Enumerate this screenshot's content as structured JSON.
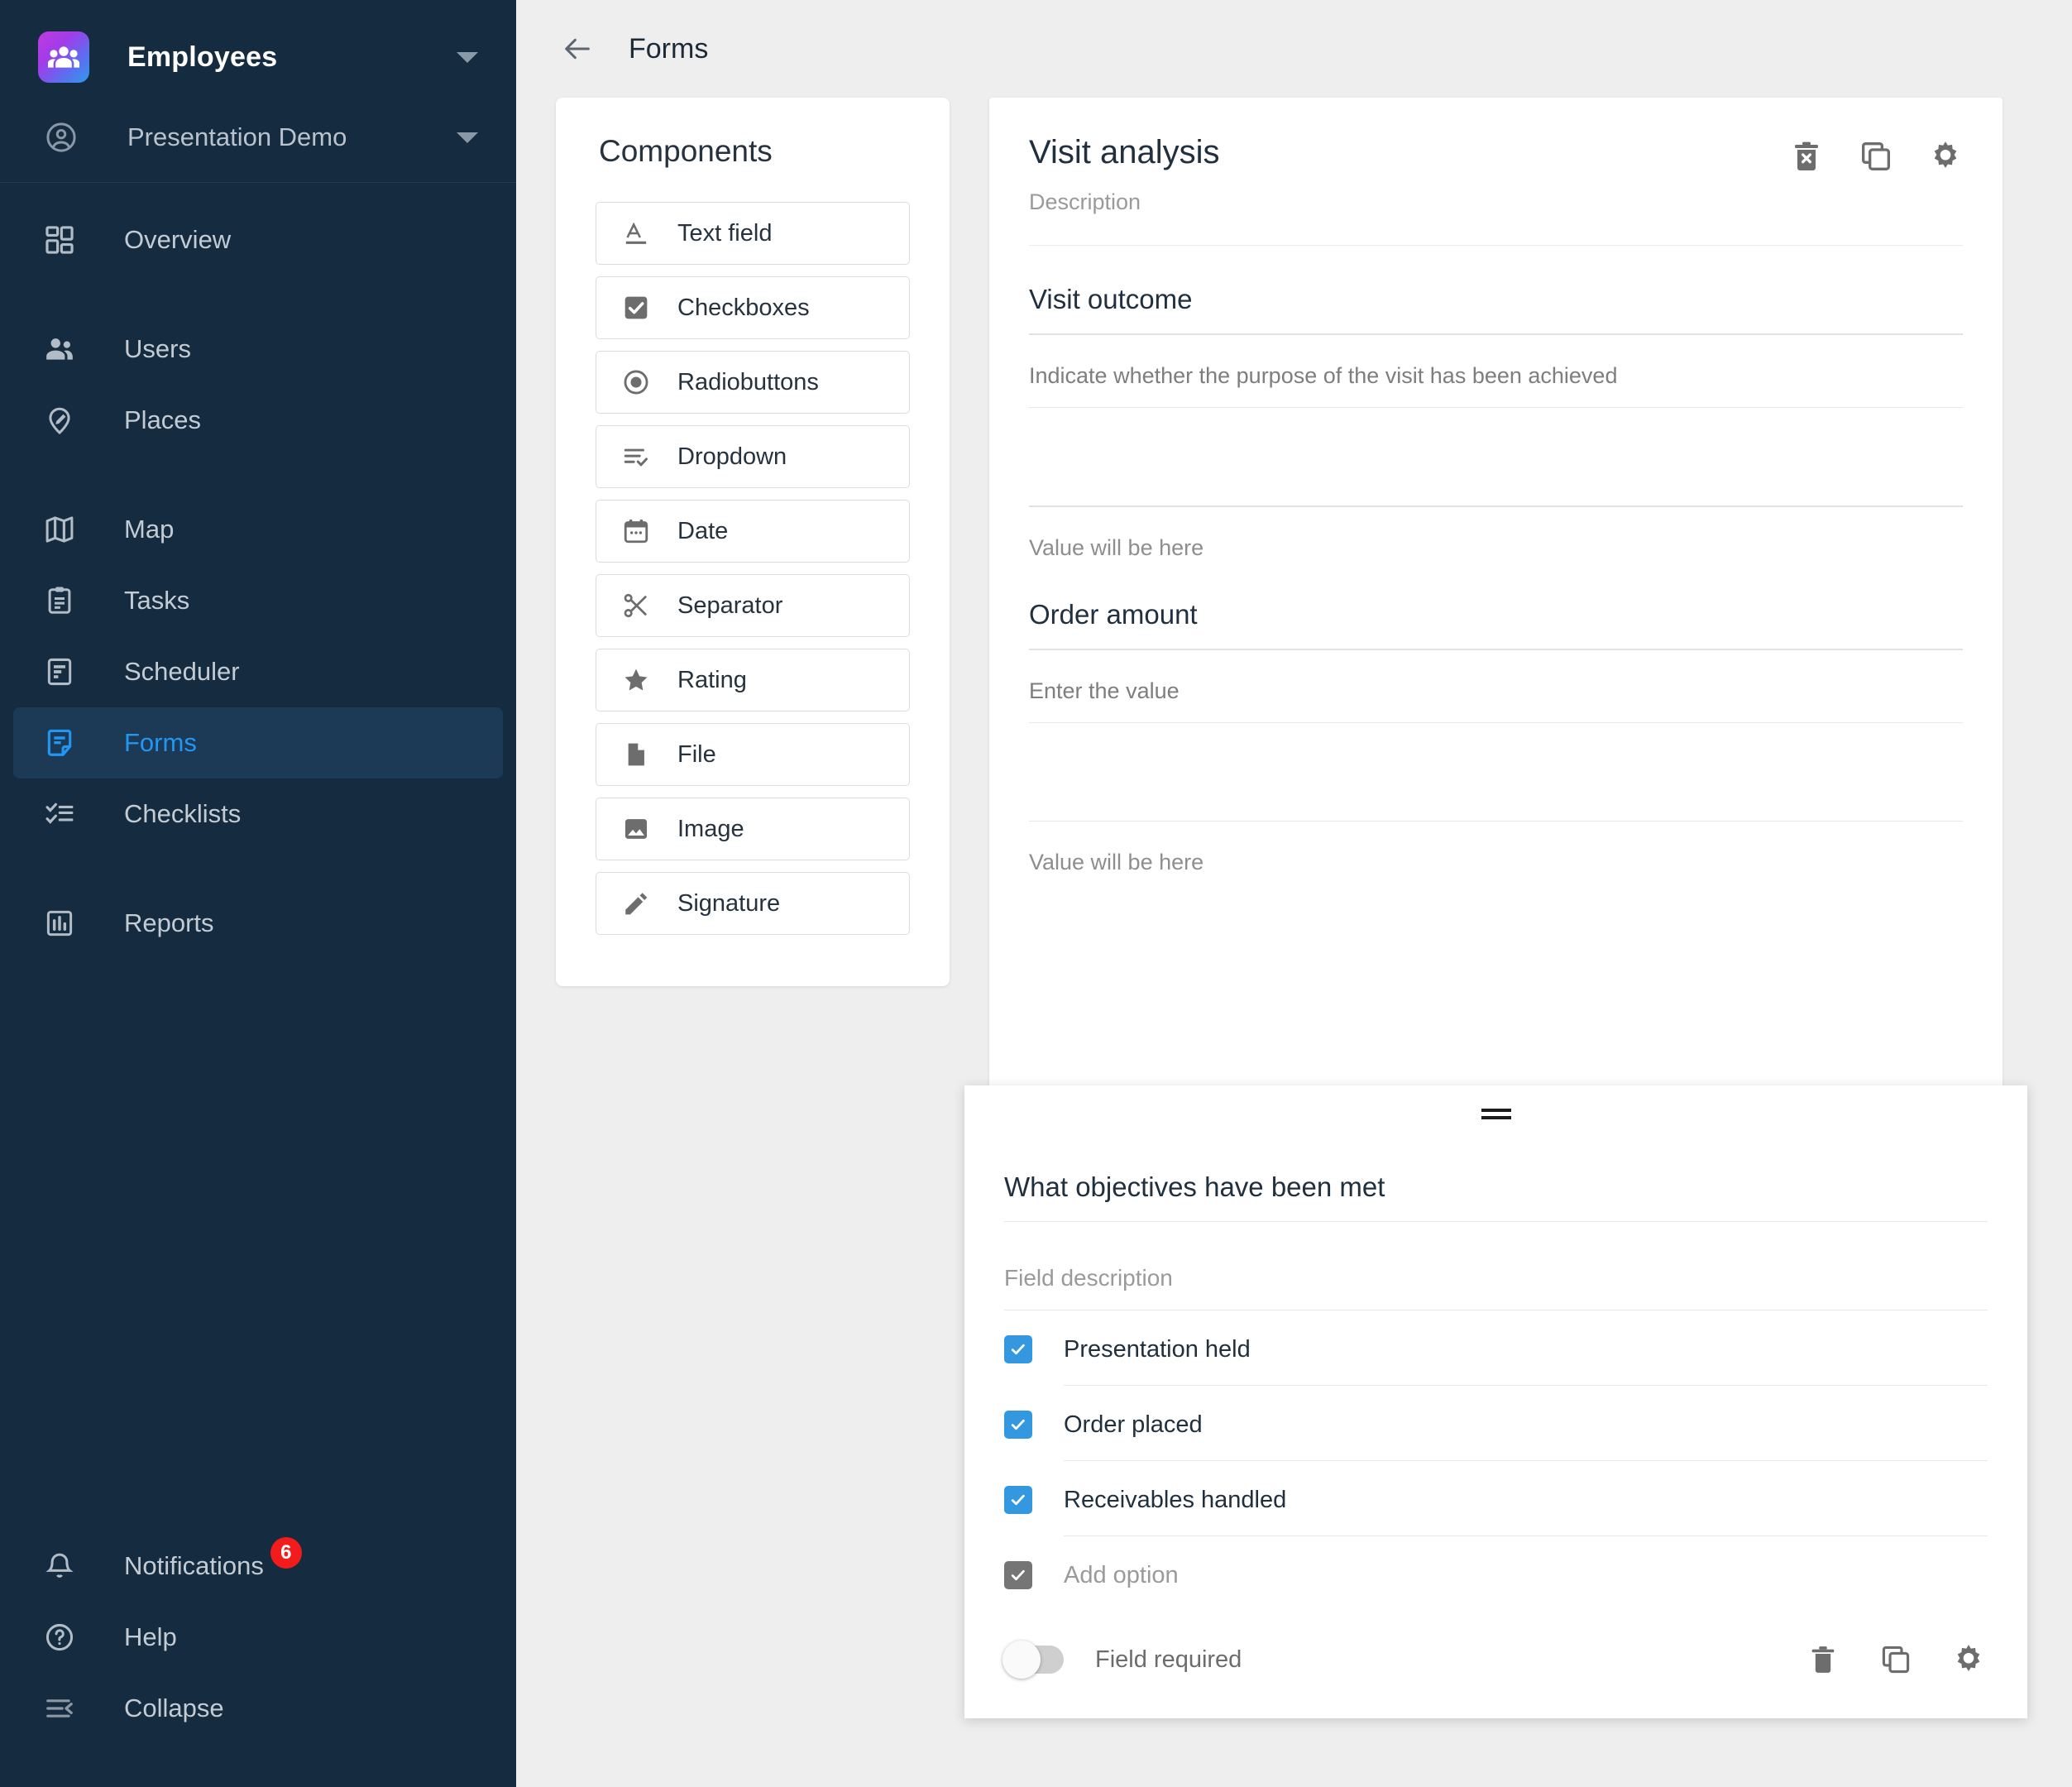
{
  "sidebar": {
    "brand": {
      "name": "Employees",
      "icon": "people-group-icon",
      "caret": "chevron-down-icon"
    },
    "account": {
      "name": "Presentation Demo",
      "icon": "account-circle-icon",
      "caret": "chevron-down-icon"
    },
    "nav": [
      {
        "label": "Overview",
        "icon": "dashboard-icon",
        "active": false
      },
      {
        "label": "Users",
        "icon": "users-icon",
        "active": false
      },
      {
        "label": "Places",
        "icon": "place-pin-edit-icon",
        "active": false
      },
      {
        "label": "Map",
        "icon": "map-icon",
        "active": false
      },
      {
        "label": "Tasks",
        "icon": "clipboard-tasks-icon",
        "active": false
      },
      {
        "label": "Scheduler",
        "icon": "scheduler-icon",
        "active": false
      },
      {
        "label": "Forms",
        "icon": "forms-icon",
        "active": true
      },
      {
        "label": "Checklists",
        "icon": "checklist-icon",
        "active": false
      },
      {
        "label": "Reports",
        "icon": "reports-bar-chart-icon",
        "active": false
      }
    ],
    "bottom": [
      {
        "label": "Notifications",
        "icon": "bell-icon",
        "badge": "6"
      },
      {
        "label": "Help",
        "icon": "help-circle-icon",
        "badge": ""
      },
      {
        "label": "Collapse",
        "icon": "collapse-menu-icon",
        "badge": ""
      }
    ]
  },
  "topbar": {
    "back_icon": "arrow-back-icon",
    "title": "Forms"
  },
  "components": {
    "title": "Components",
    "items": [
      {
        "label": "Text field",
        "icon": "text-field-icon"
      },
      {
        "label": "Checkboxes",
        "icon": "checkbox-icon"
      },
      {
        "label": "Radiobuttons",
        "icon": "radio-button-icon"
      },
      {
        "label": "Dropdown",
        "icon": "dropdown-list-icon"
      },
      {
        "label": "Date",
        "icon": "calendar-icon"
      },
      {
        "label": "Separator",
        "icon": "scissors-icon"
      },
      {
        "label": "Rating",
        "icon": "star-icon"
      },
      {
        "label": "File",
        "icon": "file-icon"
      },
      {
        "label": "Image",
        "icon": "image-icon"
      },
      {
        "label": "Signature",
        "icon": "pencil-icon"
      }
    ]
  },
  "form": {
    "title": "Visit analysis",
    "description_placeholder": "Description",
    "actions": [
      {
        "name": "delete-form-button",
        "icon": "trash-x-icon"
      },
      {
        "name": "duplicate-form-button",
        "icon": "copy-icon"
      },
      {
        "name": "form-settings-button",
        "icon": "gear-icon"
      }
    ],
    "fields": [
      {
        "title": "Visit outcome",
        "description": "Indicate whether the purpose of the visit has been achieved",
        "value_placeholder": "Value will be here"
      },
      {
        "title": "Order amount",
        "description": "Enter the value",
        "value_placeholder": "Value will be here"
      }
    ]
  },
  "selected_field": {
    "drag_handle_icon": "drag-handle-icon",
    "title": "What objectives have been met",
    "description_placeholder": "Field description",
    "options": [
      {
        "label": "Presentation held",
        "checked": true,
        "muted": false
      },
      {
        "label": "Order placed",
        "checked": true,
        "muted": false
      },
      {
        "label": "Receivables handled",
        "checked": true,
        "muted": false
      },
      {
        "label": "Add option",
        "checked": true,
        "muted": true
      }
    ],
    "required_toggle": {
      "label": "Field required",
      "on": false
    },
    "actions": [
      {
        "name": "delete-field-button",
        "icon": "trash-icon"
      },
      {
        "name": "duplicate-field-button",
        "icon": "copy-icon"
      },
      {
        "name": "field-settings-button",
        "icon": "gear-icon"
      }
    ]
  },
  "colors": {
    "sidebar_bg": "#152b3f",
    "sidebar_active_bg": "#1c3a55",
    "accent": "#2196f3",
    "checkbox_on": "#3498e0",
    "badge": "#f21c1c",
    "page_bg": "#eeeeee"
  }
}
